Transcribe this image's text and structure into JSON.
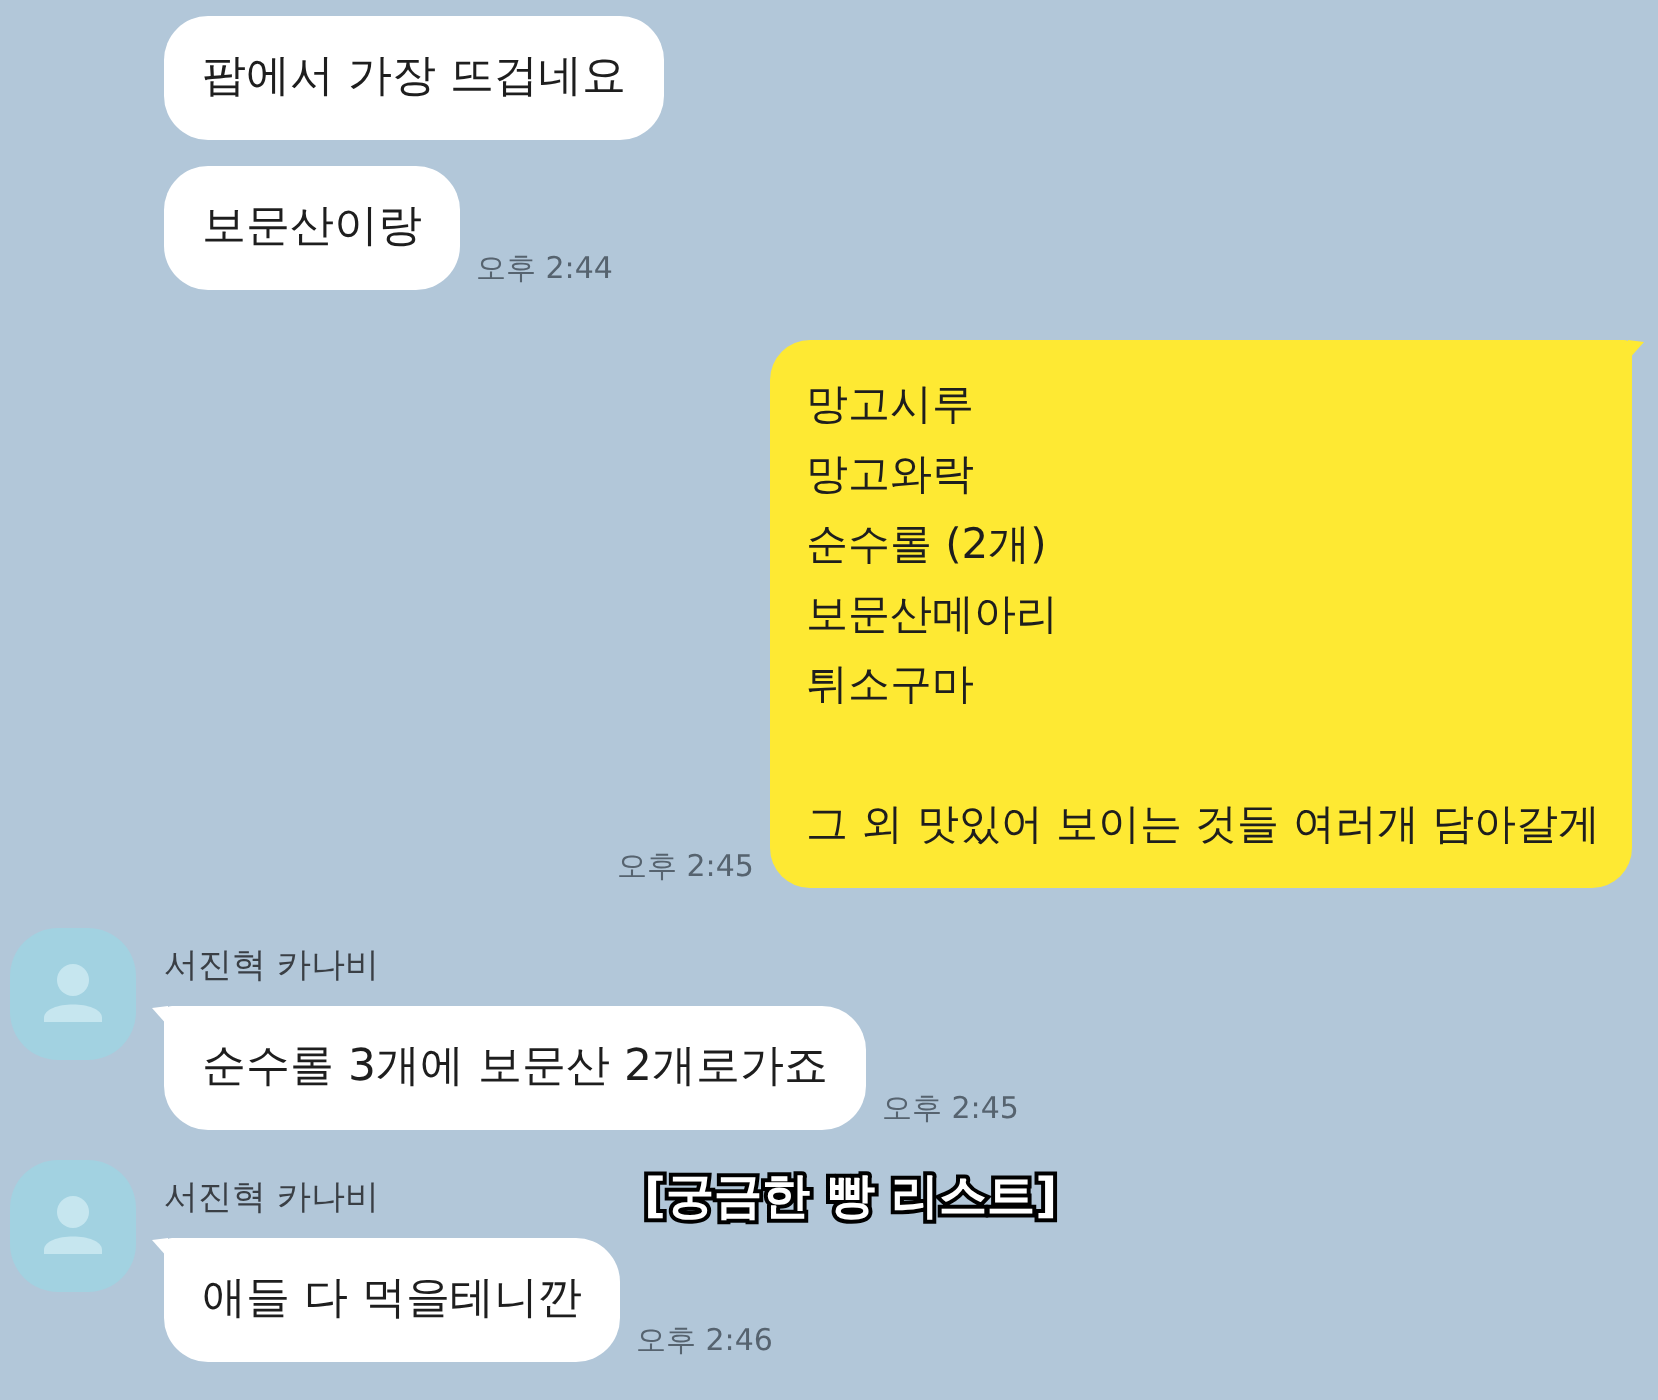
{
  "messages": [
    {
      "kind": "received",
      "text": "팝에서 가장 뜨겁네요"
    },
    {
      "kind": "received",
      "text": "보문산이랑",
      "time": "오후 2:44"
    },
    {
      "kind": "sent",
      "paragraphs": [
        [
          "망고시루",
          "망고와락",
          "순수롤 (2개)",
          "보문산메아리",
          "튀소구마"
        ],
        [
          "그 외 맛있어 보이는 것들 여러개 담아갈게"
        ]
      ],
      "time": "오후 2:45"
    },
    {
      "kind": "received",
      "sender": "서진혁 카나비",
      "text": "순수롤 3개에 보문산 2개로가죠",
      "time": "오후 2:45"
    },
    {
      "kind": "received",
      "sender": "서진혁 카나비",
      "text": "애들 다 먹을테니깐",
      "time": "오후 2:46"
    }
  ],
  "caption": "[궁금한 빵 리스트]"
}
